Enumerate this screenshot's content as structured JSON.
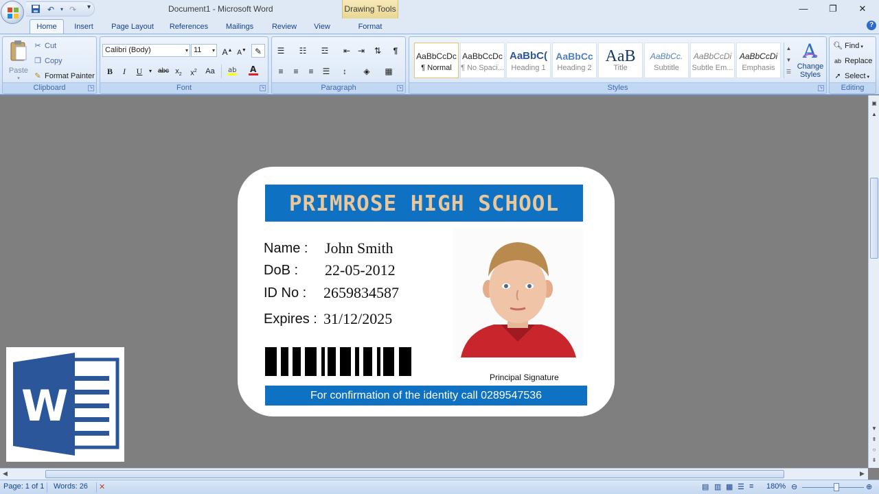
{
  "app": {
    "title": "Document1 - Microsoft Word",
    "context_tab": "Drawing Tools"
  },
  "window_controls": {
    "minimize": "—",
    "restore": "❐",
    "close": "✕"
  },
  "qat": {
    "save": "save-icon",
    "undo": "↶",
    "redo": "↷",
    "customize": "▾"
  },
  "tabs": [
    {
      "label": "Home",
      "active": true
    },
    {
      "label": "Insert"
    },
    {
      "label": "Page Layout"
    },
    {
      "label": "References"
    },
    {
      "label": "Mailings"
    },
    {
      "label": "Review"
    },
    {
      "label": "View"
    },
    {
      "label": "Format"
    }
  ],
  "ribbon": {
    "clipboard": {
      "label": "Clipboard",
      "paste": "Paste",
      "cut": "Cut",
      "copy": "Copy",
      "format_painter": "Format Painter"
    },
    "font": {
      "label": "Font",
      "family": "Calibri (Body)",
      "size": "11"
    },
    "paragraph": {
      "label": "Paragraph"
    },
    "styles": {
      "label": "Styles",
      "items": [
        {
          "sample": "AaBbCcDc",
          "name": "¶ Normal",
          "selected": true
        },
        {
          "sample": "AaBbCcDc",
          "name": "¶ No Spaci..."
        },
        {
          "sample": "AaBbC(",
          "name": "Heading 1"
        },
        {
          "sample": "AaBbCc",
          "name": "Heading 2"
        },
        {
          "sample": "AaB",
          "name": "Title"
        },
        {
          "sample": "AaBbCc.",
          "name": "Subtitle"
        },
        {
          "sample": "AaBbCcDi",
          "name": "Subtle Em..."
        },
        {
          "sample": "AaBbCcDi",
          "name": "Emphasis"
        }
      ],
      "change_styles": "Change Styles"
    },
    "editing": {
      "label": "Editing",
      "find": "Find",
      "replace": "Replace",
      "select": "Select"
    }
  },
  "card": {
    "school": "PRIMROSE HIGH SCHOOL",
    "fields": [
      {
        "label": "Name :",
        "value": "John Smith"
      },
      {
        "label": "DoB :",
        "value": "22-05-2012"
      },
      {
        "label": "ID No :",
        "value": "2659834587"
      },
      {
        "label": "Expires :",
        "value": "31/12/2025"
      }
    ],
    "signature": "Principal Signature",
    "confirm": "For confirmation of the identity  call 0289547536"
  },
  "status": {
    "page": "Page: 1 of 1",
    "words": "Words: 26",
    "zoom": "180%"
  },
  "colors": {
    "card_band": "#0f71c1",
    "school_text": "#e8c79c",
    "word_blue": "#2b579a"
  }
}
